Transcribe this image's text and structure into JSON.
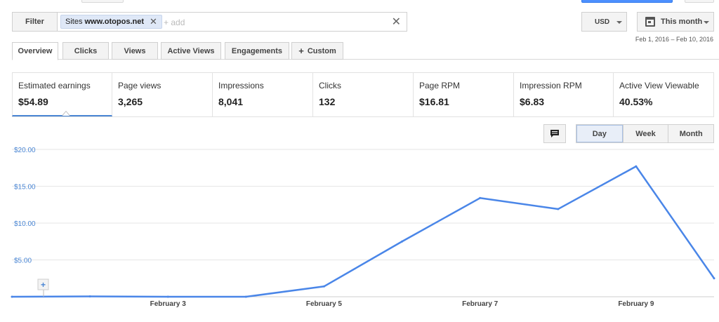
{
  "filter": {
    "button_label": "Filter",
    "chip_prefix": "Sites",
    "chip_value": "www.otopos.net",
    "add_placeholder": "+ add"
  },
  "currency": {
    "label": "USD"
  },
  "date": {
    "label": "This month",
    "range": "Feb 1, 2016 – Feb 10, 2016"
  },
  "tabs": [
    {
      "label": "Overview"
    },
    {
      "label": "Clicks"
    },
    {
      "label": "Views"
    },
    {
      "label": "Active Views"
    },
    {
      "label": "Engagements"
    },
    {
      "label": "Custom"
    }
  ],
  "kpis": [
    {
      "label": "Estimated earnings",
      "value": "$54.89"
    },
    {
      "label": "Page views",
      "value": "3,265"
    },
    {
      "label": "Impressions",
      "value": "8,041"
    },
    {
      "label": "Clicks",
      "value": "132"
    },
    {
      "label": "Page RPM",
      "value": "$16.81"
    },
    {
      "label": "Impression RPM",
      "value": "$6.83"
    },
    {
      "label": "Active View Viewable",
      "value": "40.53%"
    }
  ],
  "granularity": {
    "day": "Day",
    "week": "Week",
    "month": "Month"
  },
  "colors": {
    "accent": "#4a86d4",
    "line": "#4a86e8"
  },
  "chart_data": {
    "type": "line",
    "title": "",
    "xlabel": "",
    "ylabel": "",
    "ylim": [
      0,
      20
    ],
    "y_ticks": [
      "$5.00",
      "$10.00",
      "$15.00",
      "$20.00"
    ],
    "x_tick_labels": [
      "February 3",
      "February 5",
      "February 7",
      "February 9"
    ],
    "grid": true,
    "series": [
      {
        "x": [
          "2016-02-01",
          "2016-02-02",
          "2016-02-03",
          "2016-02-04",
          "2016-02-05",
          "2016-02-06",
          "2016-02-07",
          "2016-02-08",
          "2016-02-09",
          "2016-02-10"
        ],
        "values": [
          0.0,
          0.05,
          0.0,
          0.0,
          1.4,
          7.5,
          13.4,
          11.9,
          17.7,
          2.5
        ]
      }
    ]
  }
}
